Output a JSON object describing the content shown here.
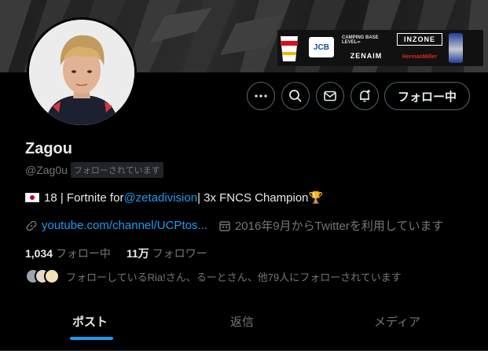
{
  "profile": {
    "name": "Zagou",
    "handle": "@Zag0u",
    "follows_you_badge": "フォローされています",
    "bio": {
      "flag_icon": "japan-flag-icon",
      "text_1": "18 | Fortnite for ",
      "mention": "@zetadivision",
      "text_2": " | 3x FNCS Champion ",
      "trophy": "🏆"
    },
    "website": "youtube.com/channel/UCPtos...",
    "joined": "2016年9月からTwitterを利用しています",
    "following_count": "1,034",
    "following_label": "フォロー中",
    "followers_count": "11万",
    "followers_label": "フォロワー",
    "known_followers_text": "フォローしているRia!さん、るーとさん、他79人にフォローされています"
  },
  "actions": {
    "more_icon": "more-horizontal-icon",
    "search_icon": "search-icon",
    "message_icon": "mail-icon",
    "notify_icon": "bell-plus-icon",
    "follow_label": "フォロー中"
  },
  "banner": {
    "sponsors": {
      "jcb": "JCB",
      "levelinfinite": "CAMPING BASE LEVEL∞",
      "zenaim": "ZENAIM",
      "inzone": "INZONE",
      "hermanmiller": "HermanMiller"
    }
  },
  "tabs": [
    {
      "label": "ポスト",
      "active": true
    },
    {
      "label": "返信",
      "active": false
    },
    {
      "label": "メディア",
      "active": false
    }
  ],
  "colors": {
    "accent": "#1d9bf0",
    "secondary_text": "#71767b",
    "border": "#536471"
  }
}
